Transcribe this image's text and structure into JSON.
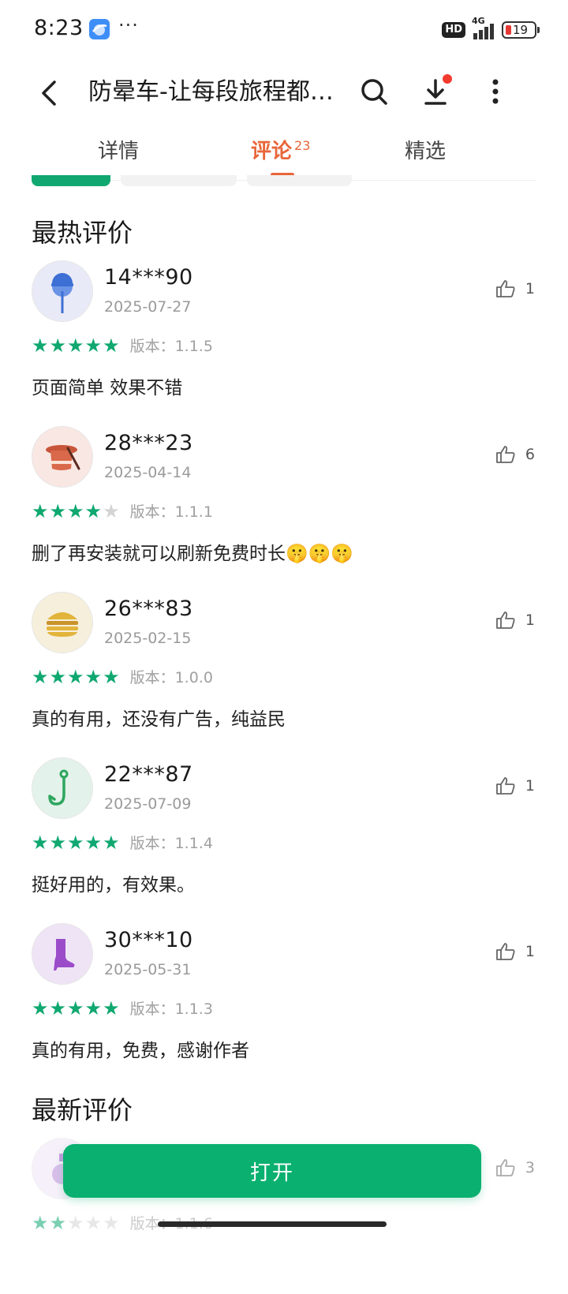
{
  "status_bar": {
    "time": "8:23",
    "dots": "···",
    "hd": "HD",
    "network": "4G",
    "battery": "19"
  },
  "header": {
    "title": "防晕车-让每段旅程都舒适",
    "icons": [
      "back-arrow-icon",
      "search-icon",
      "download-icon",
      "more-vertical-icon"
    ]
  },
  "tabs": [
    {
      "label": "详情"
    },
    {
      "label": "评论",
      "count": "23"
    },
    {
      "label": "精选"
    }
  ],
  "sections": {
    "hot_title": "最热评价",
    "new_title": "最新评价"
  },
  "reviews": [
    {
      "user": "14***90",
      "date": "2025-07-27",
      "likes": "1",
      "rating": 5,
      "version": "版本：1.1.5",
      "text": "页面简单 效果不错",
      "avatar": "lollipop-icon"
    },
    {
      "user": "28***23",
      "date": "2025-04-14",
      "likes": "6",
      "rating": 4,
      "version": "版本：1.1.1",
      "text": "删了再安装就可以刷新免费时长🤫🤫🤫",
      "avatar": "magic-hat-icon"
    },
    {
      "user": "26***83",
      "date": "2025-02-15",
      "likes": "1",
      "rating": 5,
      "version": "版本：1.0.0",
      "text": "真的有用，还没有广告，纯益民",
      "avatar": "burger-icon"
    },
    {
      "user": "22***87",
      "date": "2025-07-09",
      "likes": "1",
      "rating": 5,
      "version": "版本：1.1.4",
      "text": "挺好用的，有效果。",
      "avatar": "fish-hook-icon"
    },
    {
      "user": "30***10",
      "date": "2025-05-31",
      "likes": "1",
      "rating": 5,
      "version": "版本：1.1.3",
      "text": "真的有用，免费，感谢作者",
      "avatar": "boot-icon"
    }
  ],
  "partial_review": {
    "likes": "3",
    "version": "版本：1.1.6"
  },
  "open_button": "打开",
  "colors": {
    "accent_green": "#0ab06f",
    "tab_active": "#e8663a",
    "star_on": "#0fa870",
    "star_off": "#d4d4d4"
  }
}
